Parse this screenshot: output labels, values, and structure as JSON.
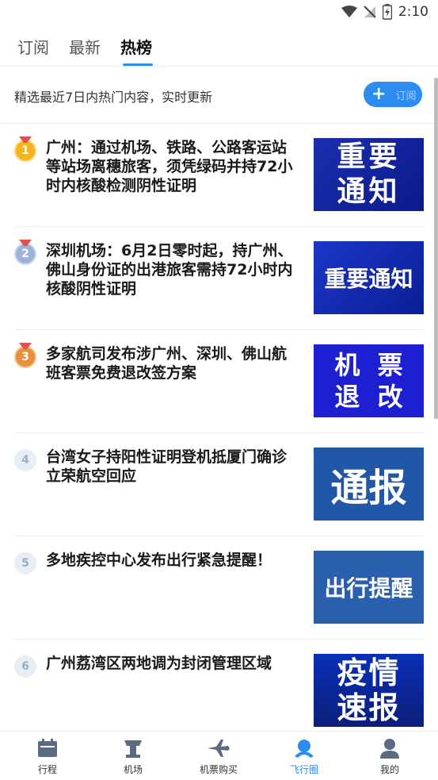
{
  "status_bar": {
    "time": "2:10"
  },
  "tabs": [
    {
      "label": "订阅"
    },
    {
      "label": "最新"
    },
    {
      "label": "热榜"
    }
  ],
  "subbar": {
    "text": "精选最近7日内热门内容，实时更新",
    "subscribe_label": "订阅"
  },
  "items": [
    {
      "rank": "1",
      "title": "广州：通过机场、铁路、公路客运站等站场离穗旅客，须凭绿码并持72小时内核酸检测阴性证明",
      "thumb_lines": [
        "重要",
        "通知"
      ]
    },
    {
      "rank": "2",
      "title": "深圳机场：6月2日零时起，持广州、佛山身份证的出港旅客需持72小时内核酸阴性证明",
      "thumb_lines": [
        "重要通知"
      ]
    },
    {
      "rank": "3",
      "title": "多家航司发布涉广州、深圳、佛山航班客票免费退改签方案",
      "thumb_lines": [
        "机  票",
        "退  改"
      ]
    },
    {
      "rank": "4",
      "title": "台湾女子持阳性证明登机抵厦门确诊立荣航空回应",
      "thumb_lines": [
        "通报"
      ]
    },
    {
      "rank": "5",
      "title": "多地疾控中心发布出行紧急提醒！",
      "thumb_lines": [
        "出行提醒"
      ]
    },
    {
      "rank": "6",
      "title": "广州荔湾区两地调为封闭管理区域",
      "thumb_lines": [
        "疫情",
        "速报"
      ]
    }
  ],
  "bottom_nav": [
    {
      "label": "行程",
      "icon": "calendar-icon"
    },
    {
      "label": "机场",
      "icon": "control-tower-icon"
    },
    {
      "label": "机票购买",
      "icon": "airplane-icon"
    },
    {
      "label": "飞行圈",
      "icon": "flight-circle-icon"
    },
    {
      "label": "我的",
      "icon": "person-icon"
    }
  ],
  "colors": {
    "accent": "#2d8cf0",
    "gold_medal": "#f4b321",
    "silver_medal": "#9fb3d9",
    "bronze_medal": "#e8913a"
  }
}
